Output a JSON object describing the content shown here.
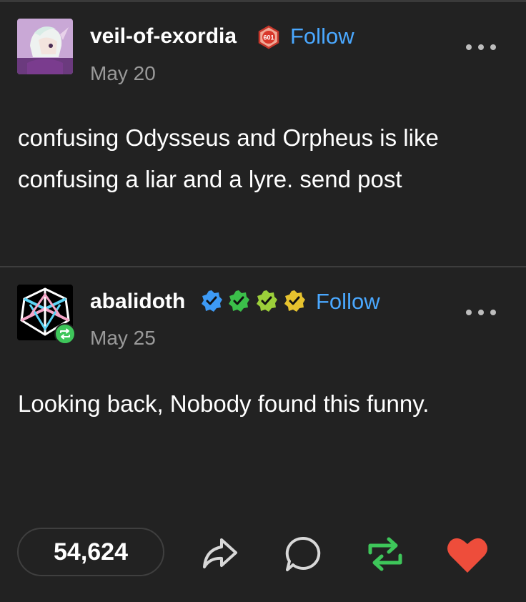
{
  "posts": [
    {
      "username": "veil-of-exordia",
      "follow_label": "Follow",
      "date": "May 20",
      "badge_text": "601",
      "body": "confusing Odysseus and Orpheus is like confusing a liar and a lyre. send post"
    },
    {
      "username": "abalidoth",
      "follow_label": "Follow",
      "date": "May 25",
      "body": "Looking back, Nobody found this funny."
    }
  ],
  "actions": {
    "notes_count": "54,624"
  },
  "colors": {
    "background": "#222222",
    "follow": "#4aa8ff",
    "reblog": "#3ec65a",
    "like": "#ee4d3b",
    "badge_blue": "#3d9af5",
    "badge_green": "#3bbf4a",
    "badge_lime": "#9ccf3a",
    "badge_yellow": "#e6c22e"
  },
  "icons": [
    "avatar-anime",
    "avatar-geometric",
    "reblog-badge-icon",
    "share-icon",
    "reply-icon",
    "reblog-icon",
    "heart-icon",
    "more-icon",
    "verified-badge-icon"
  ]
}
